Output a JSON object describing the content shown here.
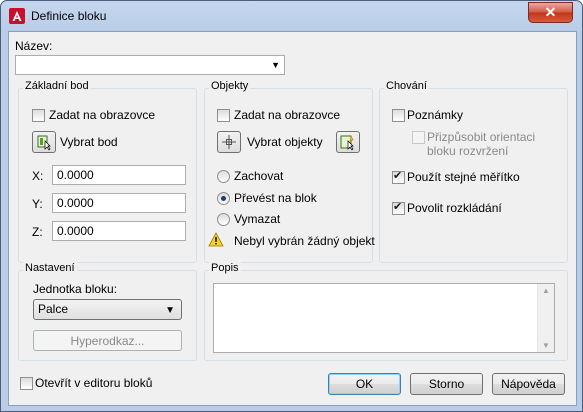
{
  "window": {
    "title": "Definice bloku",
    "close_label": "✕"
  },
  "name": {
    "label": "Název:",
    "value": ""
  },
  "base_point": {
    "title": "Základní bod",
    "specify_on_screen": "Zadat na obrazovce",
    "pick_point": "Vybrat bod",
    "x_label": "X:",
    "x_value": "0.0000",
    "y_label": "Y:",
    "y_value": "0.0000",
    "z_label": "Z:",
    "z_value": "0.0000"
  },
  "objects": {
    "title": "Objekty",
    "specify_on_screen": "Zadat na obrazovce",
    "select_objects": "Vybrat objekty",
    "retain": "Zachovat",
    "convert": "Převést na blok",
    "delete": "Vymazat",
    "warning": "Nebyl vybrán žádný objekt"
  },
  "behavior": {
    "title": "Chování",
    "annotative": "Poznámky",
    "match_orientation": "Přizpůsobit orientaci bloku rozvržení",
    "uniform_scale": "Použít stejné měřítko",
    "allow_explode": "Povolit rozkládání"
  },
  "settings": {
    "title": "Nastavení",
    "block_unit_label": "Jednotka bloku:",
    "block_unit_value": "Palce",
    "hyperlink": "Hyperodkaz..."
  },
  "description": {
    "title": "Popis",
    "value": ""
  },
  "footer": {
    "open_in_editor": "Otevřít v editoru bloků",
    "ok": "OK",
    "cancel": "Storno",
    "help": "Nápověda"
  }
}
